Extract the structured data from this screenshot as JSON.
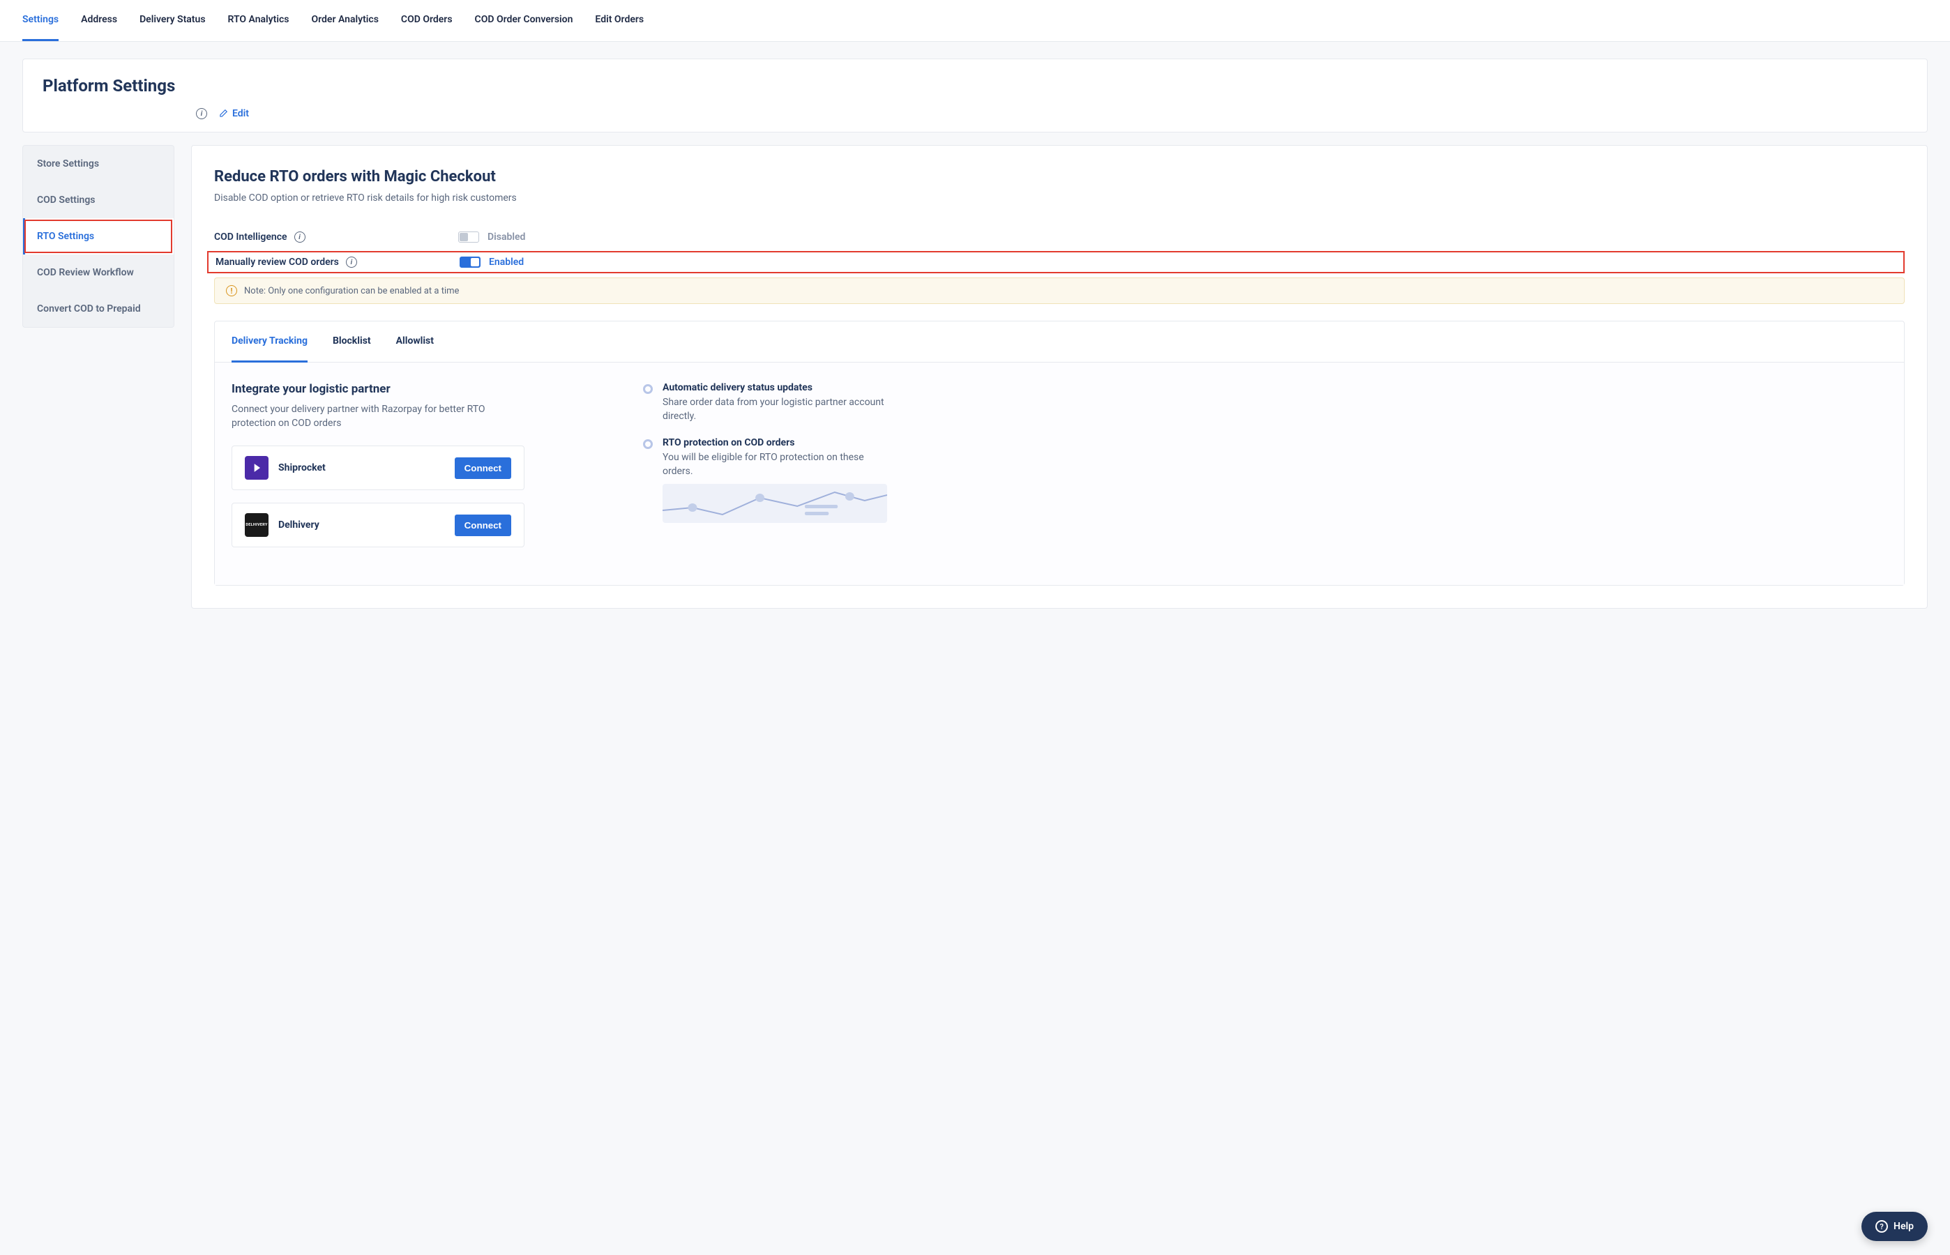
{
  "topNav": {
    "items": [
      "Settings",
      "Address",
      "Delivery Status",
      "RTO Analytics",
      "Order Analytics",
      "COD Orders",
      "COD Order Conversion",
      "Edit Orders"
    ],
    "activeIndex": 0
  },
  "header": {
    "title": "Platform Settings",
    "editLabel": "Edit"
  },
  "sidebar": {
    "items": [
      "Store Settings",
      "COD Settings",
      "RTO Settings",
      "COD Review Workflow",
      "Convert COD to Prepaid"
    ],
    "activeIndex": 2
  },
  "main": {
    "title": "Reduce RTO orders with Magic Checkout",
    "subtitle": "Disable COD option or retrieve RTO risk details for high risk customers",
    "settings": {
      "codIntelLabel": "COD Intelligence",
      "codIntelState": "Disabled",
      "manualReviewLabel": "Manually review COD orders",
      "manualReviewState": "Enabled"
    },
    "note": "Note: Only one configuration can be enabled at a time",
    "tabs": [
      "Delivery Tracking",
      "Blocklist",
      "Allowlist"
    ],
    "activeTab": 0,
    "integrate": {
      "title": "Integrate your logistic partner",
      "desc": "Connect your delivery partner with Razorpay for better RTO protection on COD orders",
      "partners": [
        {
          "name": "Shiprocket",
          "logoBg": "#4b2aa8",
          "action": "Connect"
        },
        {
          "name": "Delhivery",
          "logoBg": "#1a1a1a",
          "logoText": "DELHIVERY",
          "action": "Connect"
        }
      ]
    },
    "benefits": [
      {
        "title": "Automatic delivery status updates",
        "desc": "Share order data from your logistic partner account directly."
      },
      {
        "title": "RTO protection on COD orders",
        "desc": "You will be eligible for RTO protection on these orders."
      }
    ]
  },
  "help": {
    "label": "Help"
  }
}
